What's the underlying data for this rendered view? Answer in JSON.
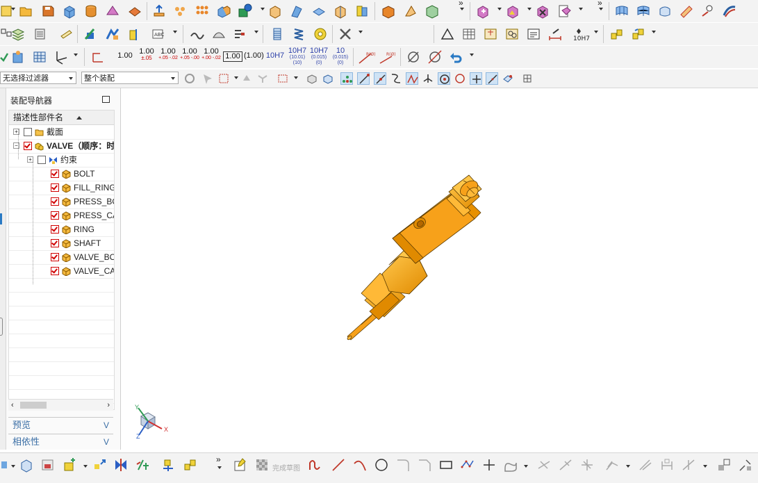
{
  "toolbar": {
    "row1_icons": [
      "new-part-icon",
      "open-icon",
      "save-icon",
      "block-icon",
      "cylinder-icon",
      "cone-icon",
      "sphere-icon",
      "extrude-icon",
      "pattern-icon",
      "array-icon",
      "boolean-unite-icon",
      "boolean-subtract-icon",
      "edge-blend-icon",
      "chamfer-icon",
      "shell-icon",
      "draft-icon",
      "trim-body-icon",
      "offset-face-icon",
      "add-component-icon",
      "create-new-component-icon",
      "replace-component-icon",
      "move-component-icon",
      "assembly-constraints-icon",
      "surface-mesh-icon",
      "surface-grid-icon",
      "surface-patch-icon",
      "surface-sweep-icon",
      "surface-extension-icon",
      "surface-blend-icon"
    ],
    "dimension_values": [
      {
        "main": "1.00",
        "sub": ""
      },
      {
        "main": "1.00",
        "sub": "±.05"
      },
      {
        "main": "1.00",
        "sub": "+.05 -.02"
      },
      {
        "main": "1.00",
        "sub": "+.05 -.00"
      },
      {
        "main": "1.00",
        "sub": "+.00 -.02"
      },
      {
        "main": "1.00",
        "sub": ""
      },
      {
        "main": "(1.00)",
        "sub": ""
      }
    ],
    "fit_values": [
      {
        "main": "10H7",
        "sub": ""
      },
      {
        "main": "10H7",
        "sub": "(10.01) (10)"
      },
      {
        "main": "10H7",
        "sub": "(0.015) (0)"
      },
      {
        "main": "10",
        "sub": "(0.015) (0)"
      }
    ],
    "radius_labels": [
      "R(Ø)",
      "R(Ø)"
    ],
    "fit_select": "10H7",
    "expand_glyph": "»"
  },
  "filterbar": {
    "type_filter_value": "无选择过滤器",
    "scope_value": "整个装配"
  },
  "navigator": {
    "title": "装配导航器",
    "column_header": "描述性部件名",
    "items": [
      {
        "label": "截面",
        "checked": false,
        "level": 1,
        "kind": "folder",
        "bold": false
      },
      {
        "label": "VALVE（顺序：时间顺序）",
        "checked": true,
        "level": 1,
        "kind": "assembly",
        "bold": true
      },
      {
        "label": "约束",
        "checked": false,
        "level": 2,
        "kind": "constraint",
        "bold": false
      },
      {
        "label": "BOLT",
        "checked": true,
        "level": 2,
        "kind": "part",
        "bold": false
      },
      {
        "label": "FILL_RING",
        "checked": true,
        "level": 2,
        "kind": "part",
        "bold": false
      },
      {
        "label": "PRESS_BOLT",
        "checked": true,
        "level": 2,
        "kind": "part",
        "bold": false
      },
      {
        "label": "PRESS_CAP",
        "checked": true,
        "level": 2,
        "kind": "part",
        "bold": false
      },
      {
        "label": "RING",
        "checked": true,
        "level": 2,
        "kind": "part",
        "bold": false
      },
      {
        "label": "SHAFT",
        "checked": true,
        "level": 2,
        "kind": "part",
        "bold": false
      },
      {
        "label": "VALVE_BODY",
        "checked": true,
        "level": 2,
        "kind": "part",
        "bold": false
      },
      {
        "label": "VALVE_CAP",
        "checked": true,
        "level": 2,
        "kind": "part",
        "bold": false
      }
    ],
    "panels": [
      {
        "label": "预览"
      },
      {
        "label": "相依性"
      }
    ],
    "chevron": "V"
  },
  "viewport": {
    "model_color": "#F7A11A",
    "triad": {
      "x": "X",
      "y": "Y",
      "z": "Z"
    }
  },
  "bottombar": {
    "finish_sketch_label": "完成草图"
  },
  "colors": {
    "toolbar_bg": "#f3f3f3",
    "accent": "#3a6ea5",
    "check_red": "#d00000",
    "model_orange": "#F7A11A"
  }
}
